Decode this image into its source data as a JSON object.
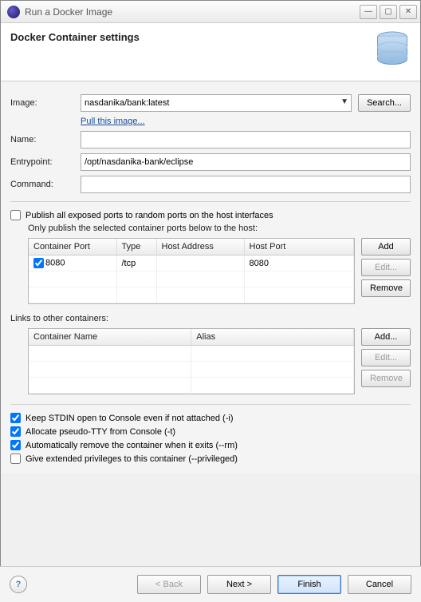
{
  "window": {
    "title": "Run a Docker Image"
  },
  "banner": {
    "heading": "Docker Container settings"
  },
  "form": {
    "image_label": "Image:",
    "image_value": "nasdanika/bank:latest",
    "search_btn": "Search...",
    "pull_link": "Pull this image...",
    "name_label": "Name:",
    "name_value": "",
    "entrypoint_label": "Entrypoint:",
    "entrypoint_value": "/opt/nasdanika-bank/eclipse",
    "command_label": "Command:",
    "command_value": ""
  },
  "ports": {
    "publish_all_chk": false,
    "publish_all_label": "Publish all exposed ports to random ports on the host interfaces",
    "sub_label": "Only publish the selected container ports below to the host:",
    "headers": {
      "container_port": "Container Port",
      "type": "Type",
      "host_addr": "Host Address",
      "host_port": "Host Port"
    },
    "rows": [
      {
        "selected": true,
        "container_port": "8080",
        "type": "/tcp",
        "host_addr": "",
        "host_port": "8080"
      }
    ],
    "add_btn": "Add",
    "edit_btn": "Edit...",
    "remove_btn": "Remove"
  },
  "links": {
    "section_label": "Links to other containers:",
    "headers": {
      "container_name": "Container Name",
      "alias": "Alias"
    },
    "rows": [],
    "add_btn": "Add...",
    "edit_btn": "Edit...",
    "remove_btn": "Remove"
  },
  "options": {
    "stdin": {
      "checked": true,
      "label": "Keep STDIN open to Console even if not attached (-i)"
    },
    "tty": {
      "checked": true,
      "label": "Allocate pseudo-TTY from Console (-t)"
    },
    "rm": {
      "checked": true,
      "label": "Automatically remove the container when it exits (--rm)"
    },
    "priv": {
      "checked": false,
      "label": "Give extended privileges to this container (--privileged)"
    }
  },
  "footer": {
    "back": "< Back",
    "next": "Next >",
    "finish": "Finish",
    "cancel": "Cancel"
  }
}
